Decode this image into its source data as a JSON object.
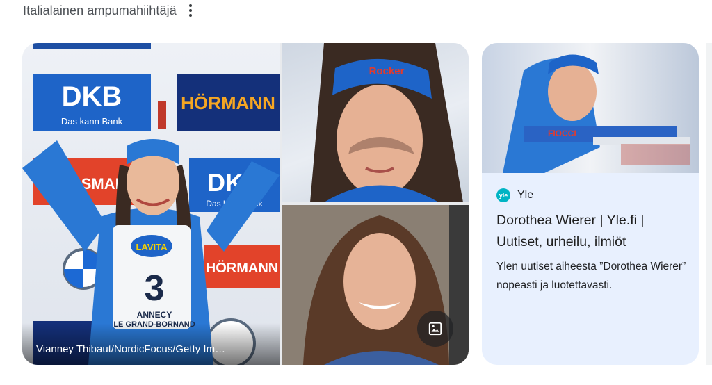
{
  "header": {
    "title": "Italialainen ampumahiihtäjä",
    "more_icon": "more-vert-icon"
  },
  "gallery": {
    "main_image": {
      "credit": "Vianney Thibaut/NordicFocus/Getty Im…",
      "banner_texts": [
        "DKB",
        "Das kann Bank",
        "HÖRMANN",
        "VIESSMANN",
        "DKB",
        "Das kann Bank",
        "HÖRMANN"
      ],
      "bib": {
        "sponsor": "LAVITA",
        "number": "3",
        "place_line1": "ANNECY",
        "place_line2": "LE GRAND-BORNAND"
      }
    },
    "top_right_image": {
      "headband_text": "Rocker"
    },
    "bottom_right_image": {
      "icon": "image-icon"
    }
  },
  "card": {
    "source": {
      "logo_text": "yle",
      "name": "Yle"
    },
    "title": "Dorothea Wierer | Yle.fi | Uutiset, urheilu, ilmiöt",
    "description": "Ylen uutiset aiheesta ”Dorothea Wierer” nopeasti ja luotettavasti.",
    "thumb_text": "FIOCCI"
  },
  "colors": {
    "accent": "#00b4c4",
    "card_bg": "#e8f0fe",
    "blue": "#1e5fb8"
  }
}
